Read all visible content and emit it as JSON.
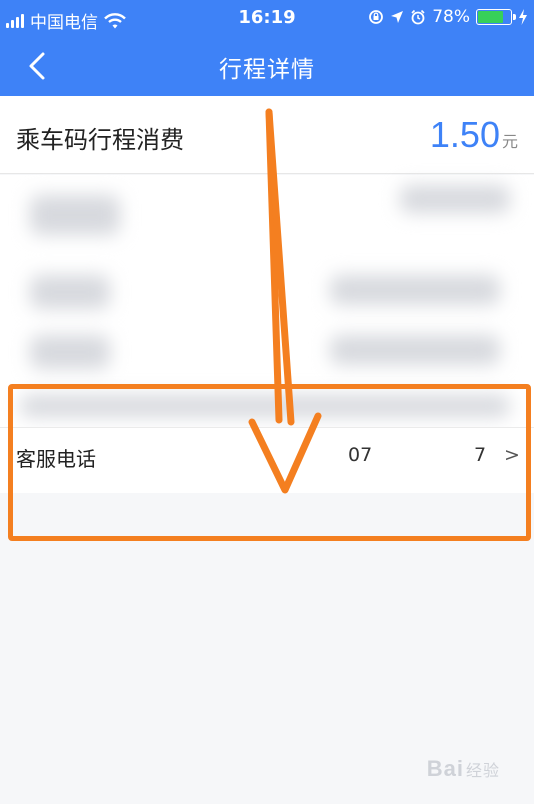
{
  "status_bar": {
    "carrier": "中国电信",
    "time": "16:19",
    "battery_percent": "78%",
    "battery_level": 0.78
  },
  "nav": {
    "title": "行程详情",
    "back_icon": "chevron-left-icon"
  },
  "trip": {
    "label": "乘车码行程消费",
    "amount": "1.50",
    "unit": "元"
  },
  "service_phone": {
    "label": "客服电话",
    "number_start": "07",
    "number_end": "7",
    "chevron": ">"
  },
  "watermark": {
    "text": "Bai",
    "sub": "经验"
  },
  "colors": {
    "brand_blue": "#3e82f7",
    "annotation_orange": "#f47f20",
    "battery_green": "#37d05a"
  }
}
